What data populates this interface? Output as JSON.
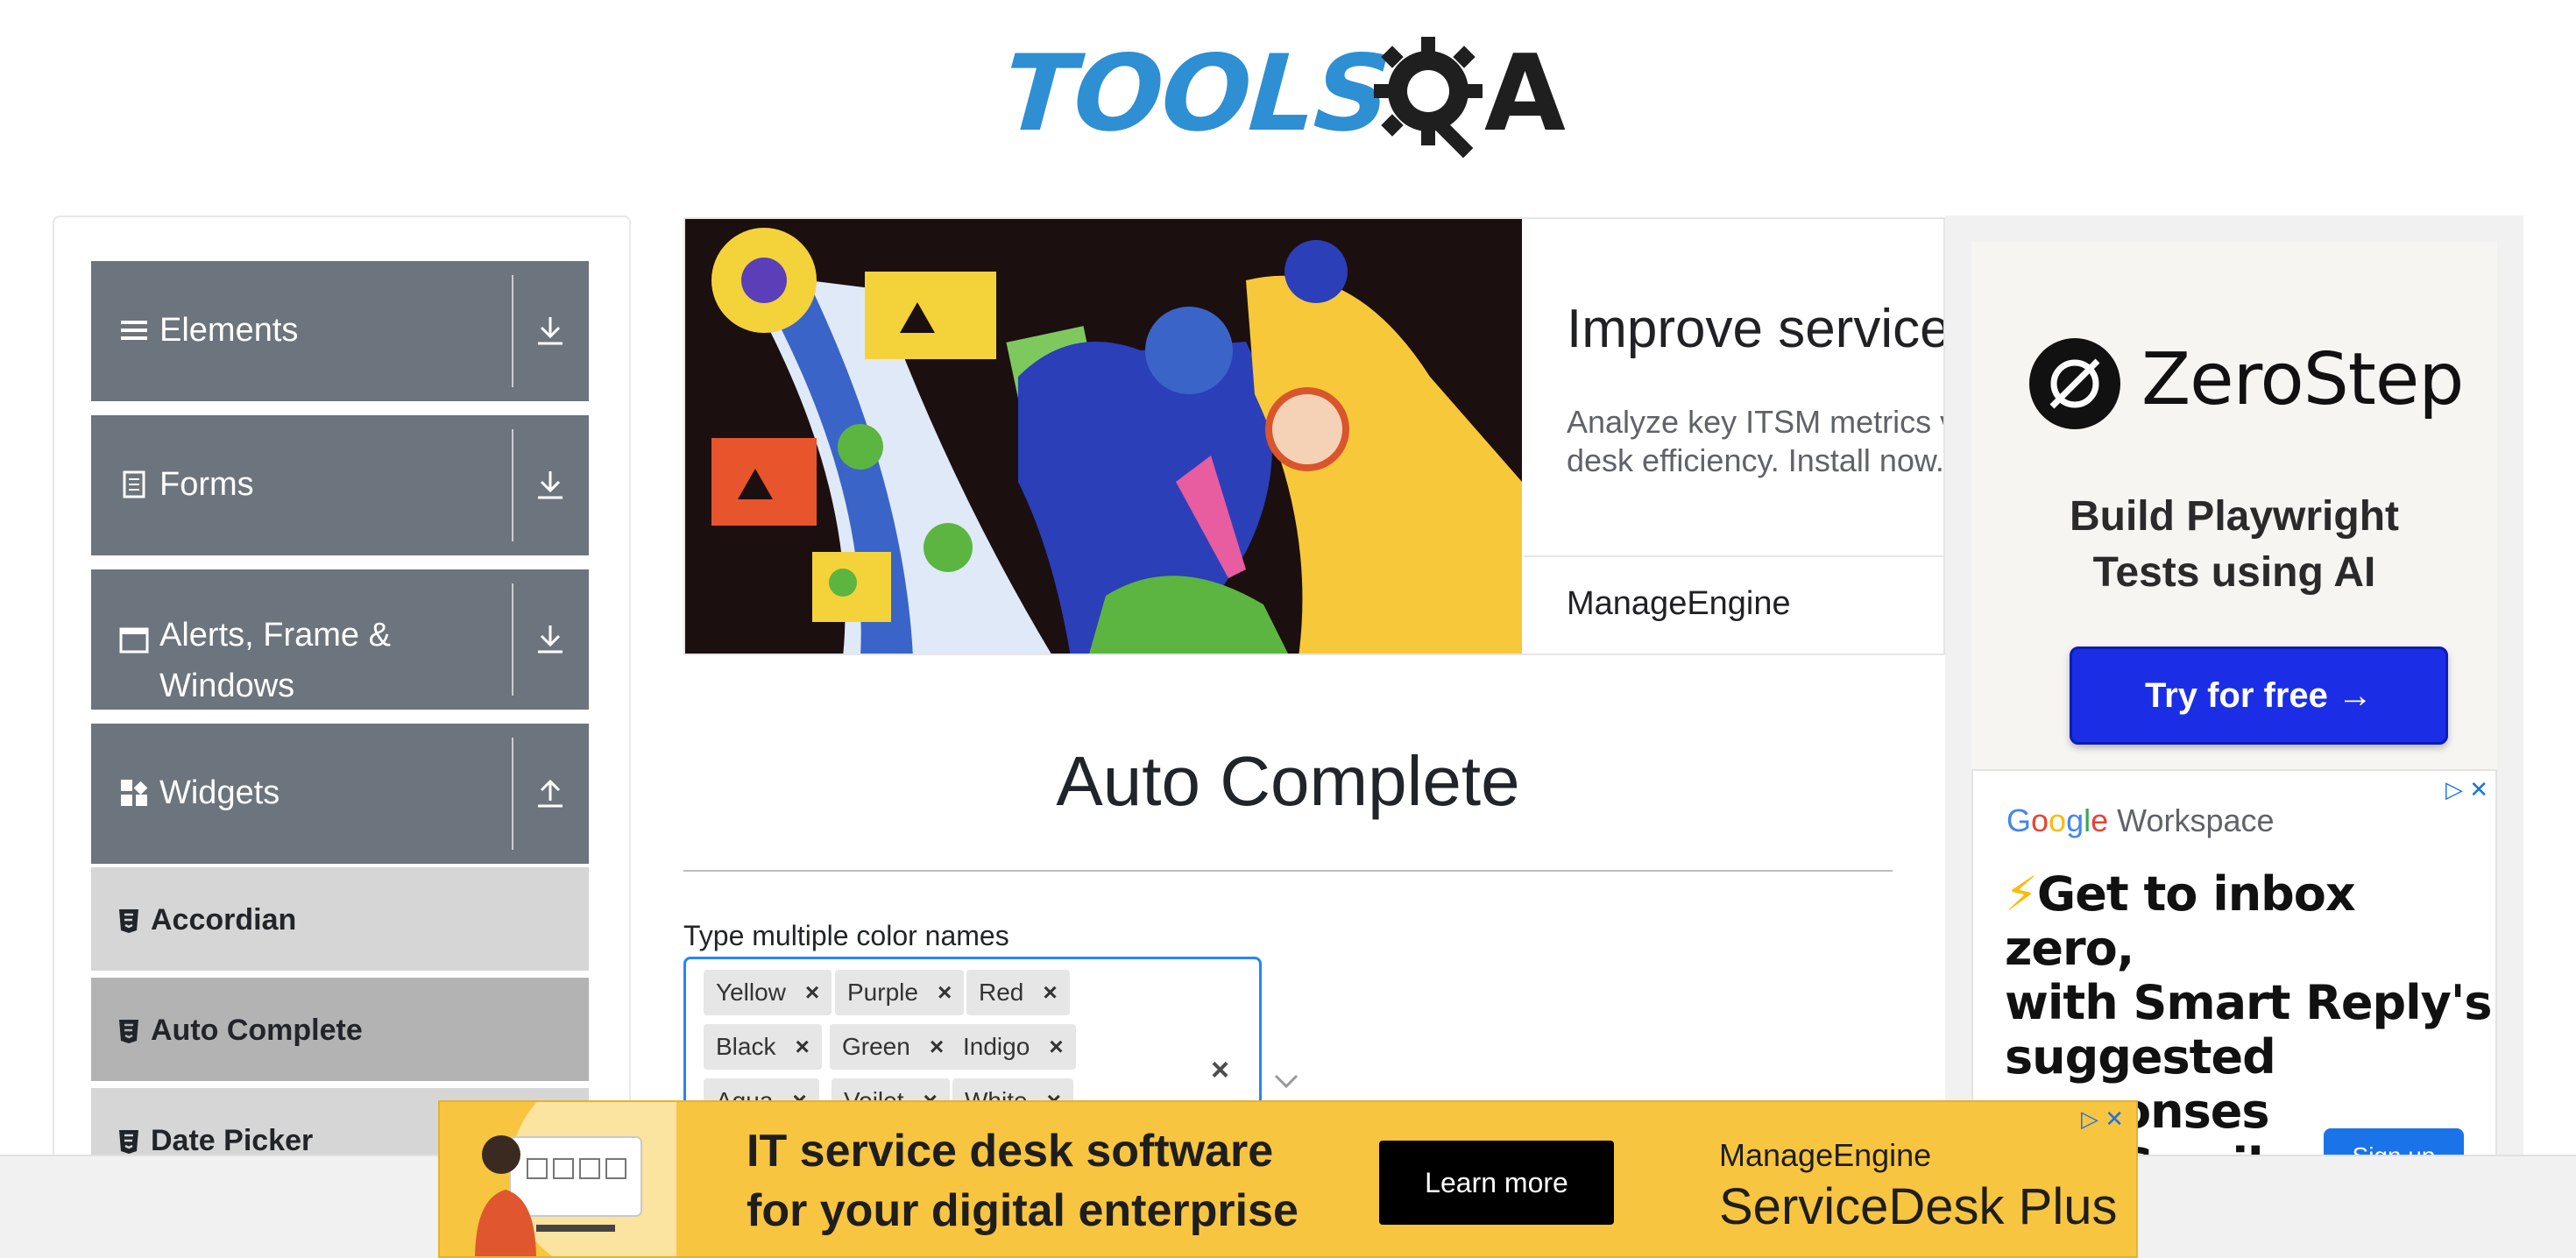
{
  "logo": {
    "primary": "TOOLS",
    "secondary": "A",
    "colors": {
      "primary": "#2e8fd3",
      "secondary": "#1f1f1f"
    }
  },
  "sidebar": {
    "groups": [
      {
        "label": "Elements",
        "icon": "hamburger-icon",
        "arrow": "download-icon"
      },
      {
        "label": "Forms",
        "icon": "document-icon",
        "arrow": "download-icon"
      },
      {
        "label": "Alerts, Frame & Windows",
        "label_line1": "Alerts, Frame &",
        "label_line2": "Windows",
        "icon": "window-icon",
        "arrow": "download-icon"
      },
      {
        "label": "Widgets",
        "icon": "grid-icon",
        "arrow": "upload-icon"
      }
    ],
    "items": [
      {
        "label": "Accordian",
        "active": false
      },
      {
        "label": "Auto Complete",
        "active": true
      },
      {
        "label": "Date Picker",
        "active": false
      }
    ]
  },
  "top_ad": {
    "title": "Improve service",
    "description_line1": "Analyze key ITSM metrics v",
    "description_line2": "desk efficiency. Install now.",
    "brand": "ManageEngine"
  },
  "main": {
    "title": "Auto Complete",
    "multi_label": "Type multiple color names",
    "chips": [
      "Yellow",
      "Purple",
      "Red",
      "Black",
      "Green",
      "Indigo",
      "Aqua",
      "Voilet",
      "White"
    ],
    "chip_remove": "×",
    "clear": "×"
  },
  "right_ad": {
    "zerostep": {
      "name": "ZeroStep",
      "tagline_line1": "Build Playwright",
      "tagline_line2": "Tests using AI",
      "cta": "Try for free →"
    },
    "workspace": {
      "brand_g": "G",
      "brand_o1": "o",
      "brand_o2": "o",
      "brand_g2": "g",
      "brand_l": "l",
      "brand_e": "e",
      "brand_rest": " Workspace",
      "headline_line1": "Get to inbox zero,",
      "headline_line2": "with Smart Reply's",
      "headline_line3": "suggested responses",
      "headline_line4_prefix": "in ",
      "headline_line4_suffix": "Gmail.",
      "signup": "Sign up"
    }
  },
  "bottom_ad": {
    "line1": "IT service desk software",
    "line2": "for your digital enterprise",
    "cta": "Learn more",
    "brand_small": "ManageEngine",
    "brand_big": "ServiceDesk Plus"
  }
}
